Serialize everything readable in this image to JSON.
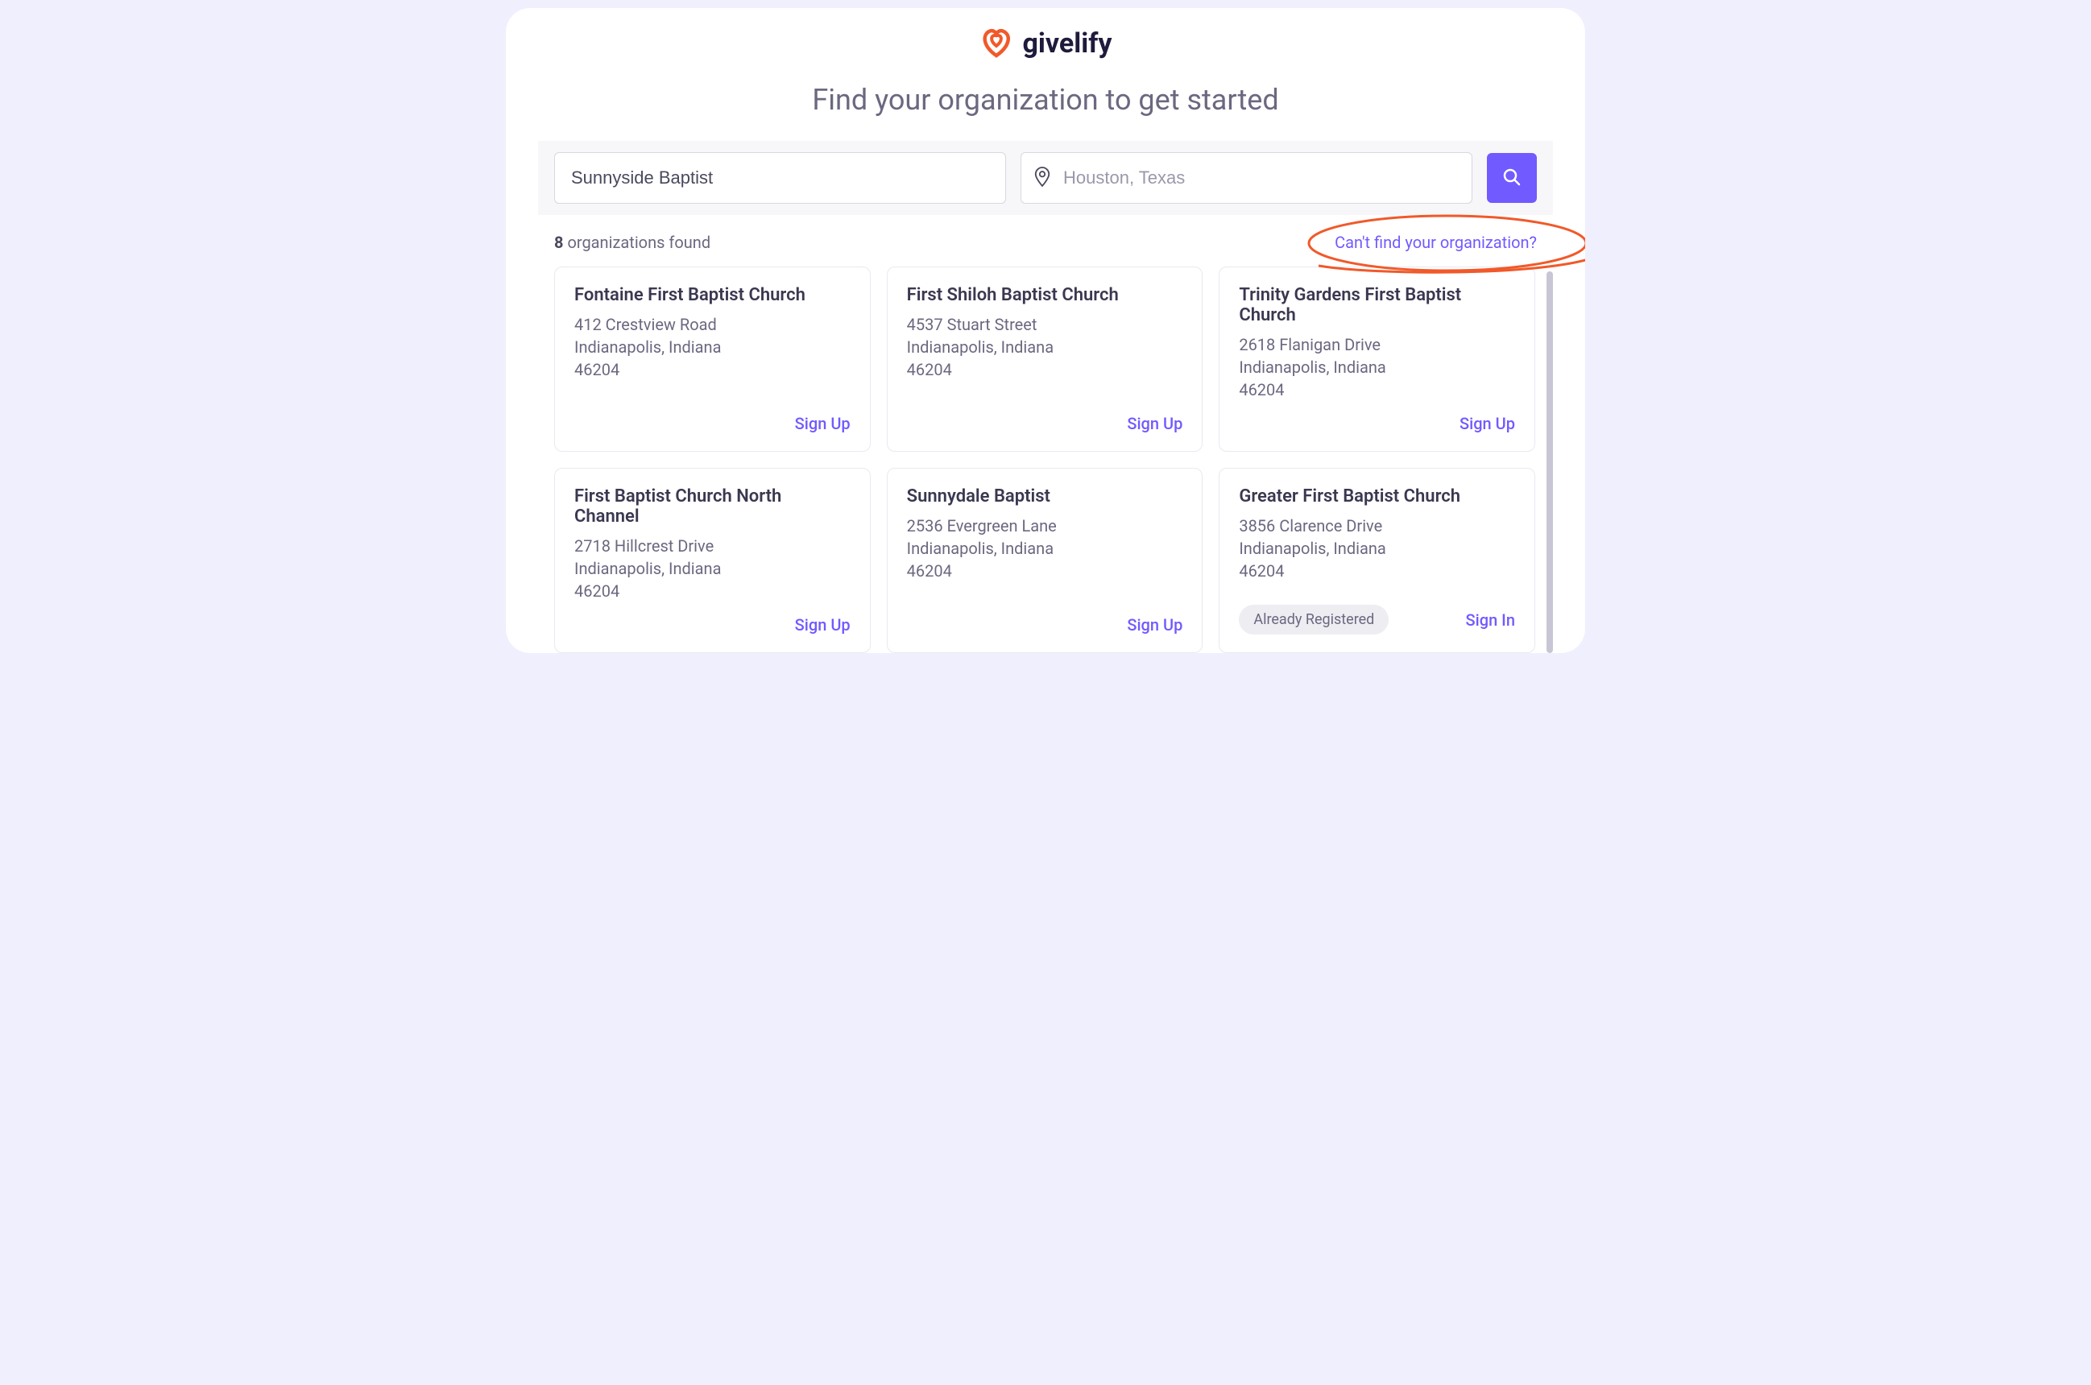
{
  "brand": {
    "name": "givelify"
  },
  "title": "Find your organization to get started",
  "search": {
    "org_value": "Sunnyside Baptist",
    "org_placeholder": "",
    "location_value": "",
    "location_placeholder": "Houston, Texas"
  },
  "results": {
    "count": "8",
    "count_suffix": "organizations found",
    "cant_find_label": "Can't find your organization?"
  },
  "labels": {
    "sign_up": "Sign Up",
    "sign_in": "Sign In",
    "already_registered": "Already Registered"
  },
  "orgs": [
    {
      "name": "Fontaine First Baptist Church",
      "street": "412 Crestview Road",
      "city": "Indianapolis, Indiana",
      "postal": "46204",
      "registered": false
    },
    {
      "name": "First Shiloh Baptist Church",
      "street": "4537 Stuart Street",
      "city": "Indianapolis, Indiana",
      "postal": "46204",
      "registered": false
    },
    {
      "name": "Trinity Gardens First Baptist Church",
      "street": "2618 Flanigan Drive",
      "city": "Indianapolis, Indiana",
      "postal": "46204",
      "registered": false
    },
    {
      "name": "First Baptist Church North Channel",
      "street": "2718 Hillcrest Drive",
      "city": "Indianapolis, Indiana",
      "postal": "46204",
      "registered": false
    },
    {
      "name": "Sunnydale Baptist",
      "street": "2536 Evergreen Lane",
      "city": "Indianapolis, Indiana",
      "postal": "46204",
      "registered": false
    },
    {
      "name": "Greater First Baptist Church",
      "street": "3856 Clarence Drive",
      "city": "Indianapolis, Indiana",
      "postal": "46204",
      "registered": true
    }
  ],
  "colors": {
    "accent": "#715AFF",
    "brandOrange": "#F1592A",
    "textMuted": "#6B6880"
  }
}
